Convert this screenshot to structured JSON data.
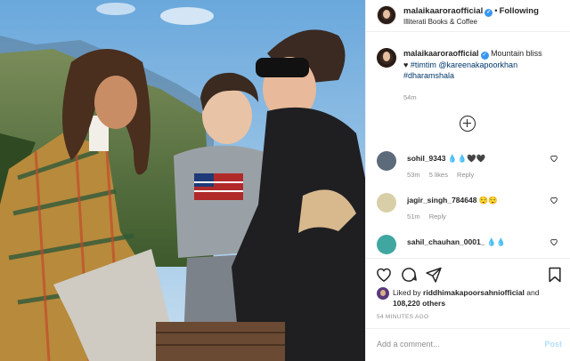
{
  "header": {
    "username": "malaikaaroraofficial",
    "separator": "•",
    "follow_label": "Following",
    "location": "Illiterati Books & Coffee"
  },
  "caption": {
    "username": "malaikaaroraofficial",
    "text": "Mountain bliss",
    "heart": "♥",
    "tags": [
      "#timtim",
      "@kareenakapoorkhan",
      "#dharamshala"
    ],
    "time": "54m"
  },
  "comments": [
    {
      "username": "sohil_9343",
      "text": "💧💧🖤🖤",
      "time": "53m",
      "likes": "5 likes",
      "reply": "Reply",
      "avatar_color": "#5c6a7a"
    },
    {
      "username": "jagir_singh_784648",
      "text": "😌😌",
      "time": "51m",
      "likes": "",
      "reply": "Reply",
      "avatar_color": "#d8cfa8"
    },
    {
      "username": "sahil_chauhan_0001_",
      "text": "💧💧",
      "time": "",
      "likes": "",
      "reply": "",
      "avatar_color": "#3fa7a0"
    }
  ],
  "likes": {
    "prefix": "Liked by",
    "user": "riddhimakapoorsahniofficial",
    "middle": "and",
    "count": "108,220 others"
  },
  "timestamp": "54 MINUTES AGO",
  "add_comment": {
    "placeholder": "Add a comment...",
    "post_label": "Post"
  },
  "icons": [
    "verified-icon",
    "load-more-icon",
    "heart-icon",
    "comment-icon",
    "share-icon",
    "save-icon"
  ],
  "colors": {
    "link": "#00376b",
    "verified": "#3897f0",
    "muted": "#8e8e8e",
    "post_disabled": "#b2dffc"
  }
}
